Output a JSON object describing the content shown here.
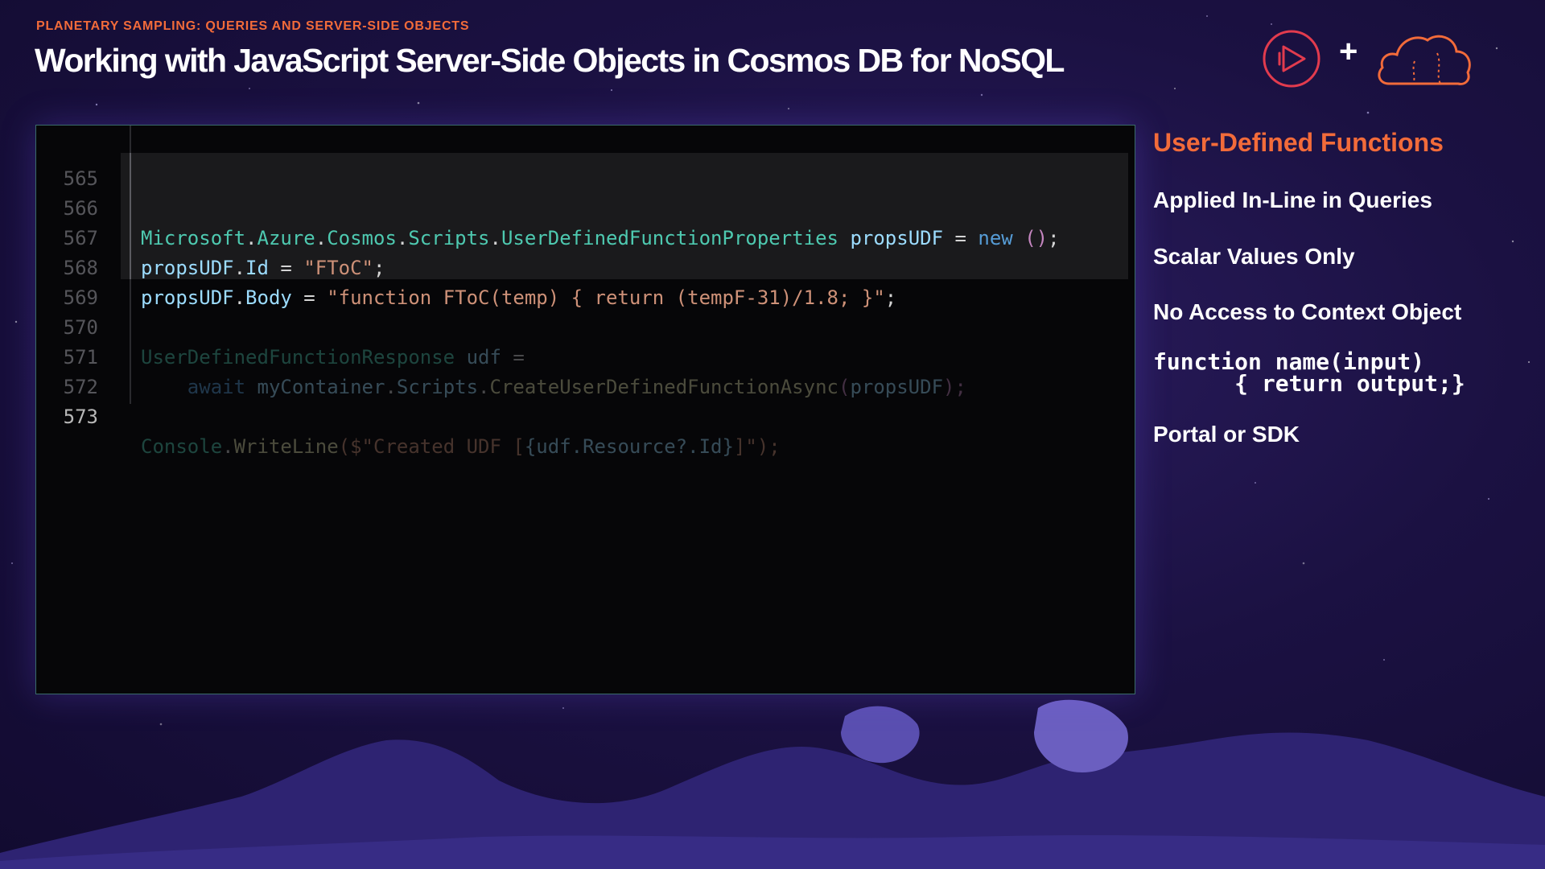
{
  "header": {
    "eyebrow": "PLANETARY SAMPLING: QUERIES AND SERVER-SIDE OBJECTS",
    "title": "Working with JavaScript Server-Side Objects in Cosmos DB for NoSQL",
    "plus_symbol": "+"
  },
  "logos": {
    "left": "play-icon",
    "right": "cloud-icon"
  },
  "editor": {
    "line_numbers": [
      "565",
      "566",
      "567",
      "568",
      "569",
      "570",
      "571",
      "572",
      "573"
    ],
    "lines": {
      "l566": {
        "a": "Microsoft",
        "b": ".",
        "c": "Azure",
        "d": ".",
        "e": "Cosmos",
        "f": ".",
        "g": "Scripts",
        "h": ".",
        "i": "UserDefinedFunctionProperties",
        "j": " propsUDF",
        "k": " = ",
        "l": "new",
        "m": " ()",
        "n": ";"
      },
      "l567": {
        "a": "propsUDF",
        "b": ".",
        "c": "Id",
        "d": " = ",
        "e": "\"FToC\"",
        "f": ";"
      },
      "l568": {
        "a": "propsUDF",
        "b": ".",
        "c": "Body",
        "d": " = ",
        "e": "\"function FToC(temp) { return (tempF-31)/1.8; }\"",
        "f": ";"
      },
      "l570": {
        "a": "UserDefinedFunctionResponse",
        "b": " udf",
        "c": " ="
      },
      "l571": {
        "a": "    await",
        "b": " myContainer",
        "c": ".",
        "d": "Scripts",
        "e": ".",
        "f": "CreateUserDefinedFunctionAsync",
        "g": "(",
        "h": "propsUDF",
        "i": ");"
      },
      "l573": {
        "a": "Console",
        "b": ".",
        "c": "WriteLine",
        "d": "($\"Created UDF [",
        "e": "{udf.Resource?.Id}",
        "f": "]\");"
      }
    }
  },
  "sidebar": {
    "heading": "User-Defined Functions",
    "items": [
      "Applied In-Line in Queries",
      "Scalar Values Only",
      "No Access to Context Object"
    ],
    "code_line1": "function name(input)",
    "code_line2": "      { return output;}",
    "last_item": "Portal or SDK"
  },
  "colors": {
    "accent": "#f26b3a",
    "background": "#1b1142",
    "editor_bg": "#060608"
  }
}
